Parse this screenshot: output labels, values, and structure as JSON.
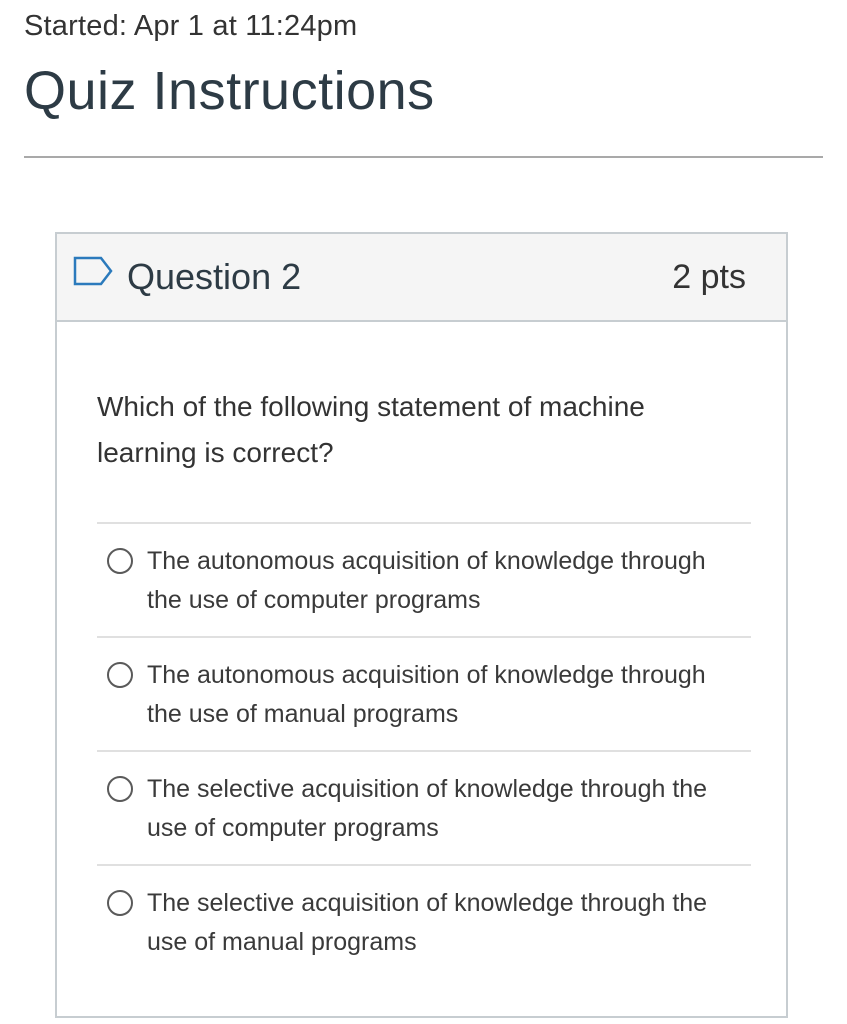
{
  "header": {
    "started": "Started: Apr 1 at 11:24pm",
    "title": "Quiz Instructions"
  },
  "question": {
    "flag_icon": "bookmark-flag-icon",
    "name": "Question 2",
    "points": "2 pts",
    "text": "Which of the following statement of machine learning is correct?",
    "answers": [
      {
        "label": "The autonomous acquisition of knowledge through the use of computer programs",
        "selected": false
      },
      {
        "label": "The autonomous acquisition of knowledge through the use of manual programs",
        "selected": false
      },
      {
        "label": "The selective acquisition of knowledge through the use of computer programs",
        "selected": false
      },
      {
        "label": "The selective acquisition of knowledge through the use of manual programs",
        "selected": false
      }
    ]
  },
  "colors": {
    "text": "#2d3b45",
    "header_bg": "#f5f5f5",
    "border": "#c7cdd1",
    "flag": "#2b7abc"
  }
}
